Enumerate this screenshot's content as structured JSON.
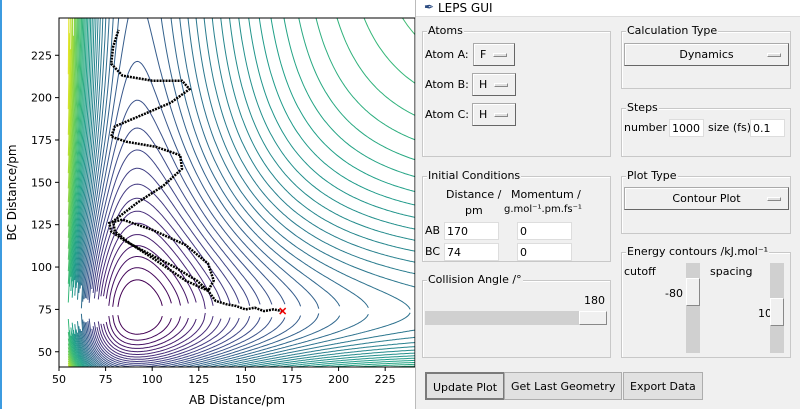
{
  "window": {
    "title": "LEPS GUI"
  },
  "atoms": {
    "legend": "Atoms",
    "a_label": "Atom A:",
    "a_value": "F",
    "b_label": "Atom B:",
    "b_value": "H",
    "c_label": "Atom C:",
    "c_value": "H"
  },
  "calc": {
    "legend": "Calculation Type",
    "value": "Dynamics"
  },
  "steps": {
    "legend": "Steps",
    "number_label": "number",
    "number_value": "1000",
    "size_label": "size (fs)",
    "size_value": "0.1"
  },
  "initial": {
    "legend": "Initial Conditions",
    "distance_header": "Distance /",
    "distance_unit": "pm",
    "momentum_header": "Momentum /",
    "momentum_unit": "g.mol⁻¹.pm.fs⁻¹",
    "ab_label": "AB",
    "bc_label": "BC",
    "ab_distance": "170",
    "bc_distance": "74",
    "ab_momentum": "0",
    "bc_momentum": "0"
  },
  "plot_type": {
    "legend": "Plot Type",
    "value": "Contour Plot"
  },
  "angle": {
    "legend": "Collision Angle /°",
    "value": "180",
    "fraction": 1.0
  },
  "contours": {
    "legend": "Energy contours /kJ.mol⁻¹",
    "cutoff_label": "cutoff",
    "cutoff_value": "-80",
    "spacing_label": "spacing",
    "spacing_value": "10"
  },
  "buttons": {
    "update": "Update Plot",
    "last_geometry": "Get Last Geometry",
    "export": "Export Data"
  },
  "chart_data": {
    "type": "contour",
    "xlabel": "AB Distance/pm",
    "ylabel": "BC Distance/pm",
    "xlim": [
      50,
      241
    ],
    "ylim": [
      41,
      247
    ],
    "xticks": [
      "50",
      "75",
      "100",
      "125",
      "150",
      "175",
      "200",
      "225"
    ],
    "yticks": [
      "50",
      "75",
      "100",
      "125",
      "150",
      "175",
      "200",
      "225"
    ],
    "start_marker": [
      170,
      74
    ],
    "trajectory": [
      [
        170,
        74
      ],
      [
        165,
        75
      ],
      [
        160,
        74
      ],
      [
        155,
        76
      ],
      [
        150,
        75
      ],
      [
        145,
        77
      ],
      [
        140,
        78
      ],
      [
        134,
        80
      ],
      [
        130,
        86
      ],
      [
        124,
        92
      ],
      [
        112,
        100
      ],
      [
        98,
        108
      ],
      [
        86,
        115
      ],
      [
        78,
        121
      ],
      [
        77,
        126
      ],
      [
        84,
        128
      ],
      [
        100,
        122
      ],
      [
        118,
        113
      ],
      [
        130,
        102
      ],
      [
        133,
        92
      ],
      [
        130,
        86
      ],
      [
        118,
        92
      ],
      [
        102,
        104
      ],
      [
        88,
        114
      ],
      [
        80,
        121
      ],
      [
        79,
        127
      ],
      [
        92,
        138
      ],
      [
        106,
        148
      ],
      [
        116,
        158
      ],
      [
        115,
        166
      ],
      [
        102,
        171
      ],
      [
        86,
        174
      ],
      [
        78,
        177
      ],
      [
        80,
        183
      ],
      [
        95,
        190
      ],
      [
        110,
        197
      ],
      [
        120,
        205
      ],
      [
        116,
        210
      ],
      [
        100,
        210
      ],
      [
        84,
        213
      ],
      [
        78,
        220
      ],
      [
        79,
        230
      ],
      [
        82,
        240
      ]
    ]
  }
}
